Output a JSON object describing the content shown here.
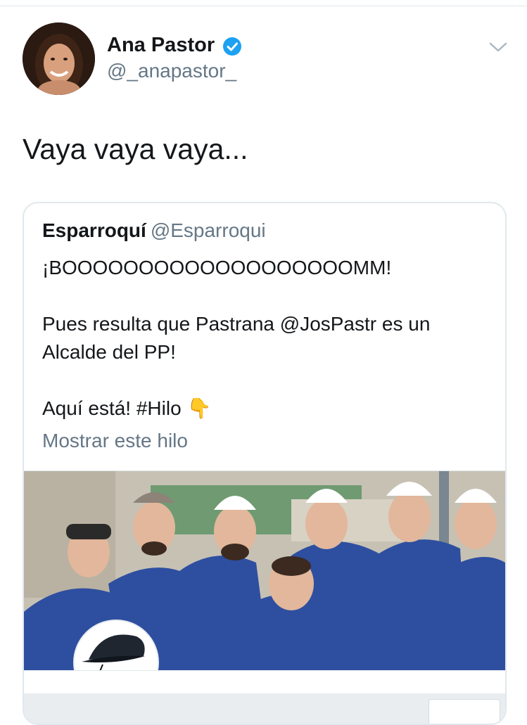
{
  "tweet": {
    "author": {
      "name": "Ana Pastor",
      "handle": "@_anapastor_",
      "avatar_icon": "profile-photo",
      "verified_icon": "verified-badge-icon"
    },
    "text": "Vaya vaya vaya...",
    "menu_icon": "chevron-down-icon"
  },
  "quoted": {
    "name": "Esparroquí",
    "handle": "@Esparroqui",
    "lines": [
      "¡BOOOOOOOOOOOOOOOOOOOMM!",
      "Pues resulta que Pastrana @JosPastr es un",
      "Alcalde del PP!",
      "Aquí está! #Hilo 👇"
    ],
    "show_thread": "Mostrar este hilo",
    "image_icon": "group-photo-workers-image"
  },
  "colors": {
    "text": "#14171a",
    "secondary": "#657786",
    "verified": "#1da1f2",
    "border": "#e1e8ed"
  }
}
